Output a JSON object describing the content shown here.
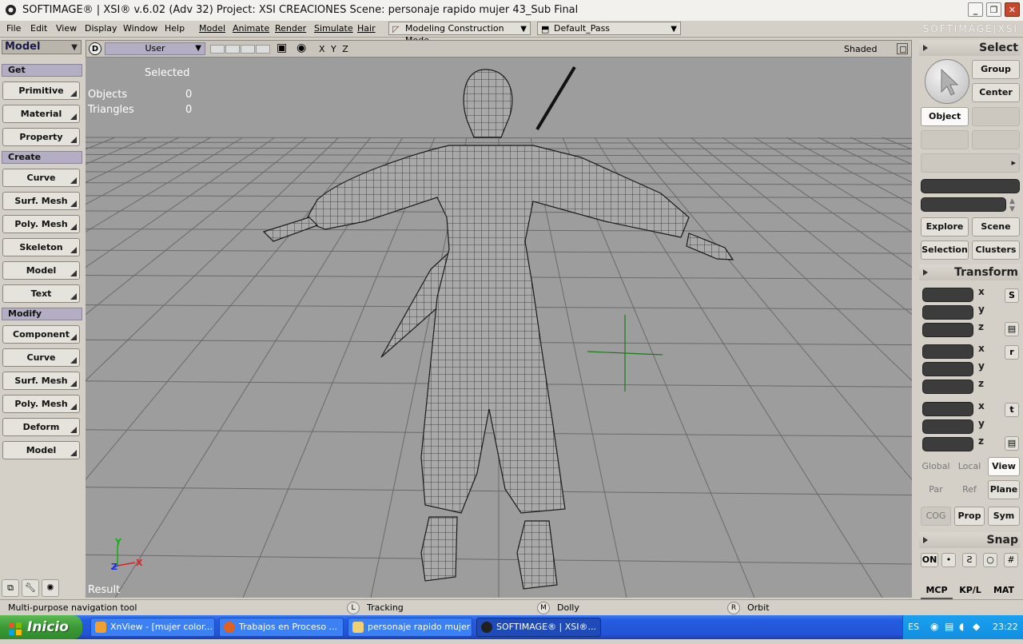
{
  "window": {
    "title": "SOFTIMAGE® | XSI® v.6.02 (Adv 32) Project: XSI CREACIONES     Scene: personaje rapido mujer 43_Sub Final",
    "brand": "SOFTIMAGE|XSI"
  },
  "menubar": {
    "items": [
      "File",
      "Edit",
      "View",
      "Display",
      "Window",
      "Help",
      "Model",
      "Animate",
      "Render",
      "Simulate",
      "Hair"
    ],
    "construction_mode": "Modeling Construction Mode",
    "pass": "Default_Pass"
  },
  "left_panel": {
    "mode": "Model",
    "get_header": "Get",
    "get_buttons": [
      "Primitive",
      "Material",
      "Property"
    ],
    "create_header": "Create",
    "create_buttons": [
      "Curve",
      "Surf. Mesh",
      "Poly. Mesh",
      "Skeleton",
      "Model",
      "Text"
    ],
    "modify_header": "Modify",
    "modify_buttons": [
      "Component",
      "Curve",
      "Surf. Mesh",
      "Poly. Mesh",
      "Deform",
      "Model"
    ]
  },
  "viewport": {
    "camera": "User",
    "axes_label": "X Y Z",
    "display_mode": "Shaded",
    "stats_header": "Selected",
    "objects_label": "Objects",
    "objects_value": "0",
    "triangles_label": "Triangles",
    "triangles_value": "0",
    "result_label": "Result",
    "axis_y": "Y",
    "axis_z": "Z",
    "axis_x": "X",
    "axis_colors": {
      "x": "#e02020",
      "y": "#10b010",
      "z": "#2030e0"
    }
  },
  "statusbar": {
    "tool_text": "Multi-purpose navigation tool",
    "l_key": "L",
    "l_label": "Tracking",
    "m_key": "M",
    "m_label": "Dolly",
    "r_key": "R",
    "r_label": "Orbit"
  },
  "right_panel": {
    "select_header": "Select",
    "group": "Group",
    "center": "Center",
    "object": "Object",
    "explore": "Explore",
    "scene": "Scene",
    "selection": "Selection",
    "clusters": "Clusters",
    "transform_header": "Transform",
    "axes": [
      "x",
      "y",
      "z"
    ],
    "scale_icon": "S",
    "rotate_icon": "r",
    "translate_icon": "t",
    "global": "Global",
    "local": "Local",
    "view": "View",
    "par": "Par",
    "ref": "Ref",
    "plane": "Plane",
    "cog": "COG",
    "prop": "Prop",
    "sym": "Sym",
    "snap_header": "Snap",
    "snap_on": "ON",
    "mcp": "MCP",
    "kpl": "KP/L",
    "mat": "MAT"
  },
  "taskbar": {
    "start": "Inicio",
    "tasks": [
      {
        "label": "XnView - [mujer color...",
        "color": "#f0a030"
      },
      {
        "label": "Trabajos en Proceso ...",
        "color": "#e06020"
      },
      {
        "label": "personaje rapido mujer",
        "color": "#f0d070"
      },
      {
        "label": "SOFTIMAGE® | XSI®...",
        "color": "#202020"
      }
    ],
    "lang": "ES",
    "clock": "23:22"
  }
}
